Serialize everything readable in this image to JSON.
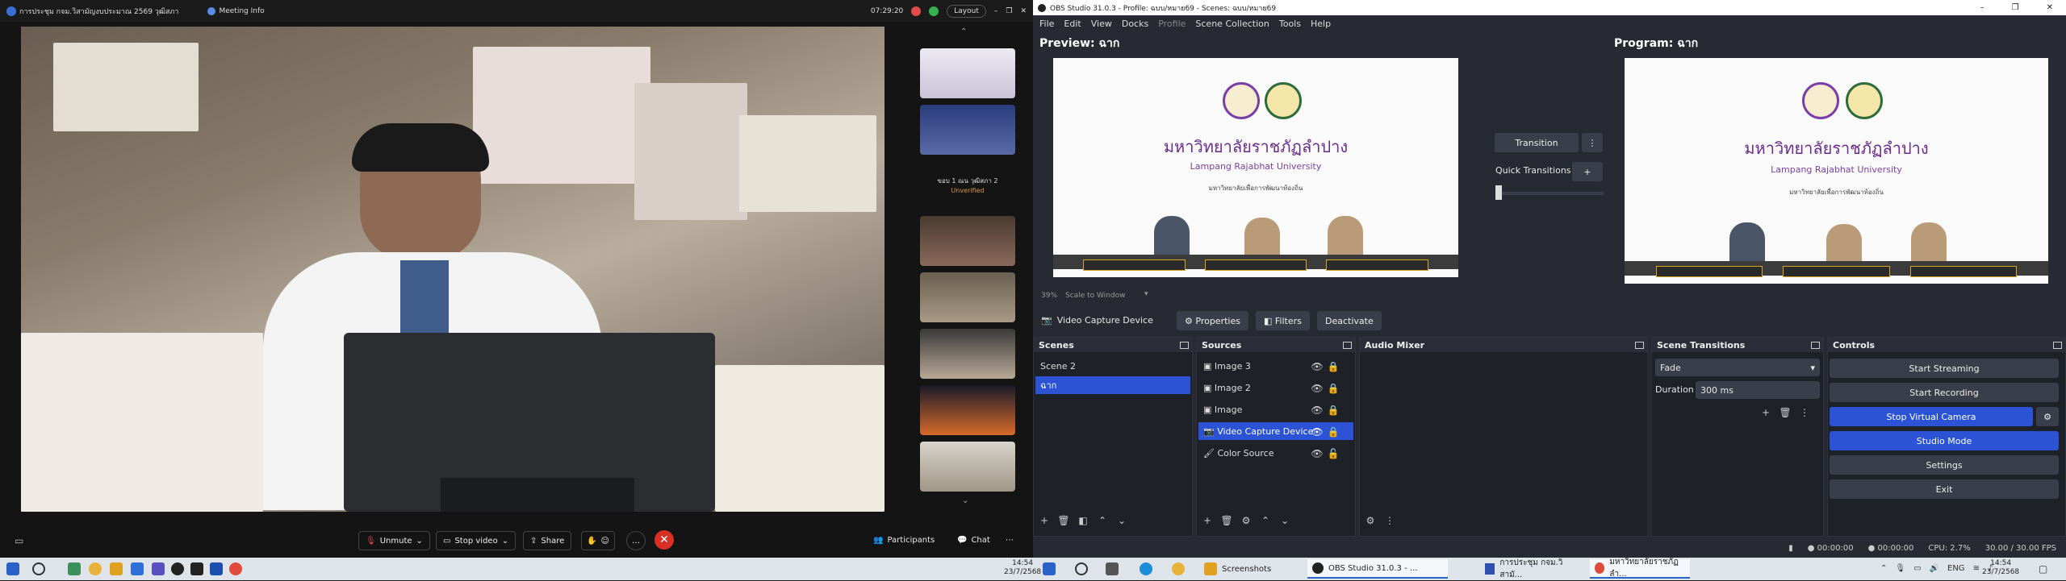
{
  "meeting": {
    "title": "การประชุม กจม.วิสามัญงบประมาณ 2569 วุฒิสภา",
    "meeting_info": "Meeting Info",
    "timer": "07:29:20",
    "layout": "Layout",
    "thumb_label_name": "ขอบ 1 ณน วุฒิสภา 2",
    "thumb_label_status": "Unverified",
    "toolbar": {
      "unmute": "Unmute",
      "stop_video": "Stop video",
      "share": "Share",
      "participants": "Participants",
      "chat": "Chat"
    },
    "clock_time": "14:54",
    "clock_date": "23/7/2568"
  },
  "obs": {
    "window_title": "OBS Studio 31.0.3 - Profile: ฉบบ/หมาย69 - Scenes: ฉบบ/หมาย69",
    "menu": [
      "File",
      "Edit",
      "View",
      "Docks",
      "Profile",
      "Scene Collection",
      "Tools",
      "Help"
    ],
    "preview_label": "Preview: ฉาก",
    "program_label": "Program: ฉาก",
    "transition_btn": "Transition",
    "quick_transitions": "Quick Transitions",
    "zoom": "39%",
    "scale_mode": "Scale to Window",
    "source_bar": {
      "name": "Video Capture Device",
      "properties": "Properties",
      "filters": "Filters",
      "deactivate": "Deactivate"
    },
    "scene_screen": {
      "thai_name": "มหาวิทยาลัยราชภัฏลำปาง",
      "english_name": "Lampang Rajabhat University",
      "tagline": "มหาวิทยาลัยเพื่อการพัฒนาท้องถิ่น"
    },
    "docks": {
      "scenes": "Scenes",
      "sources": "Sources",
      "audio_mixer": "Audio Mixer",
      "scene_transitions": "Scene Transitions",
      "controls": "Controls"
    },
    "scenes": [
      "Scene 2",
      "ฉาก"
    ],
    "sources": [
      "Image 3",
      "Image 2",
      "Image",
      "Video Capture Device",
      "Color Source"
    ],
    "transition_type": "Fade",
    "duration_label": "Duration",
    "duration_value": "300 ms",
    "controls": [
      "Start Streaming",
      "Start Recording",
      "Stop Virtual Camera",
      "Studio Mode",
      "Settings",
      "Exit"
    ],
    "status": {
      "stream_time": "00:00:00",
      "rec_time": "00:00:00",
      "cpu": "CPU: 2.7%",
      "fps": "30.00 / 30.00 FPS"
    }
  },
  "taskbar": {
    "tasks": [
      "Screenshots",
      "OBS Studio 31.0.3 - ...",
      "การประชุม กจม.วิสามั...",
      "มหาวิทยาลัยราชภัฏลำ..."
    ],
    "lang": "ENG",
    "time": "14:54",
    "date": "23/7/2568"
  }
}
